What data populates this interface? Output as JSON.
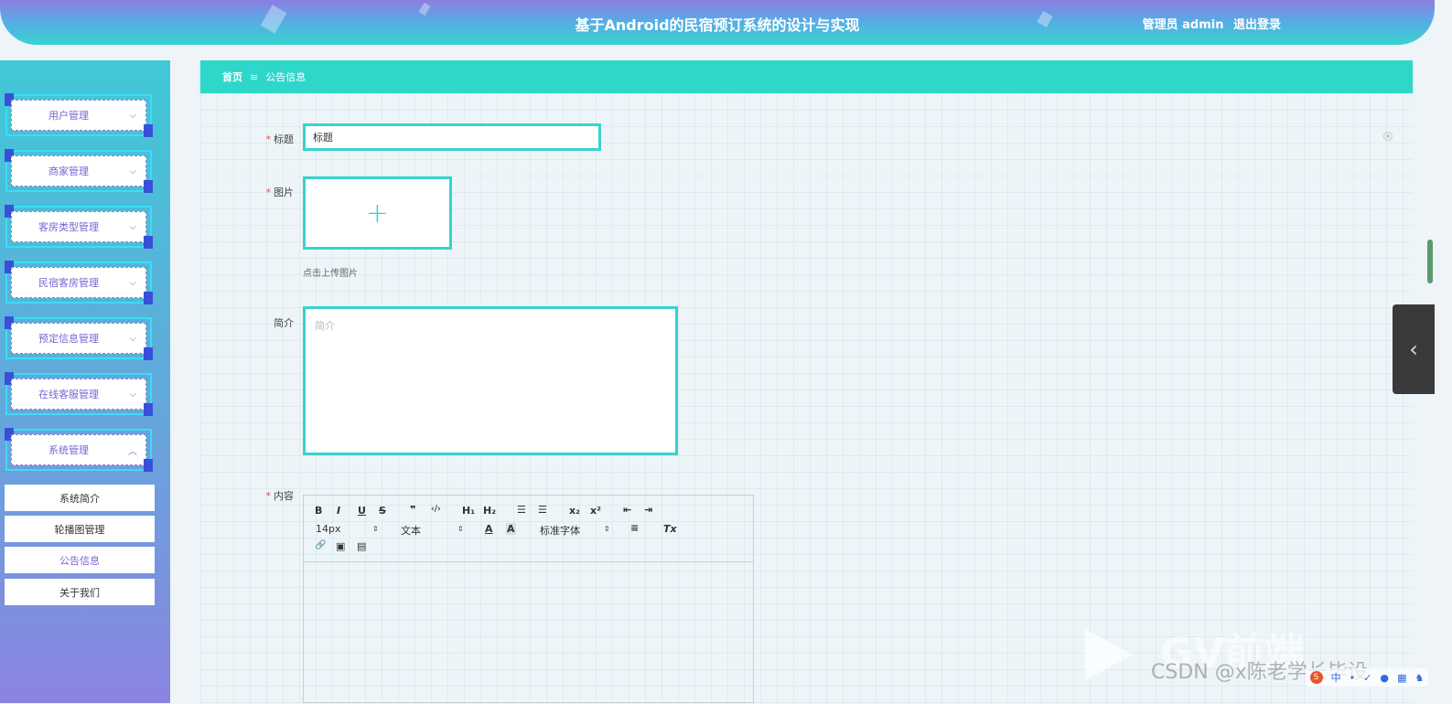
{
  "header": {
    "title": "基于Android的民宿预订系统的设计与实现",
    "user_role": "管理员",
    "user_name": "admin",
    "logout_label": "退出登录"
  },
  "sidebar": {
    "menus": [
      {
        "label": "用户管理",
        "chevron": "⌵"
      },
      {
        "label": "商家管理",
        "chevron": "⌵"
      },
      {
        "label": "客房类型管理",
        "chevron": "⌵"
      },
      {
        "label": "民宿客房管理",
        "chevron": "⌵"
      },
      {
        "label": "预定信息管理",
        "chevron": "⌵"
      },
      {
        "label": "在线客服管理",
        "chevron": "⌵"
      },
      {
        "label": "系统管理",
        "chevron": "︿"
      }
    ],
    "submenu": [
      {
        "label": "系统简介"
      },
      {
        "label": "轮播图管理"
      },
      {
        "label": "公告信息"
      },
      {
        "label": "关于我们"
      }
    ]
  },
  "breadcrumb": {
    "home": "首页",
    "separator": "≡",
    "current": "公告信息"
  },
  "form": {
    "title_label": "标题",
    "title_value": "标题",
    "image_label": "图片",
    "upload_plus": "+",
    "upload_hint": "点击上传图片",
    "brief_label": "简介",
    "brief_placeholder": "简介",
    "content_label": "内容",
    "required_mark": "*"
  },
  "editor": {
    "bold": "B",
    "italic": "I",
    "underline": "U",
    "strike": "S",
    "quote": "❞",
    "code": "‹/›",
    "h1": "H₁",
    "h2": "H₂",
    "ordered_list": "☰",
    "bullet_list": "☰",
    "subscript": "x₂",
    "superscript": "x²",
    "outdent": "⇤",
    "indent": "⇥",
    "font_size": "14px",
    "header_select": "文本",
    "font_color": "A",
    "bg_color": "A",
    "font_family": "标准字体",
    "align": "≡",
    "clean": "Tx",
    "link": "🔗",
    "image": "▣",
    "video": "▤",
    "select_arrow": "⇕"
  },
  "drawer_handle": "‹",
  "watermark": {
    "text": "CSDN @x陈老学长毕设",
    "big": "GV前端"
  },
  "ime": {
    "logo": "S",
    "chars": [
      "中",
      "•",
      "✓",
      "●",
      "▦",
      "♞",
      "⌘"
    ]
  },
  "colors": {
    "accent": "#36d3cf",
    "menu_text": "#7a63d4",
    "breadcrumb_bg": "#2fd7cb"
  }
}
